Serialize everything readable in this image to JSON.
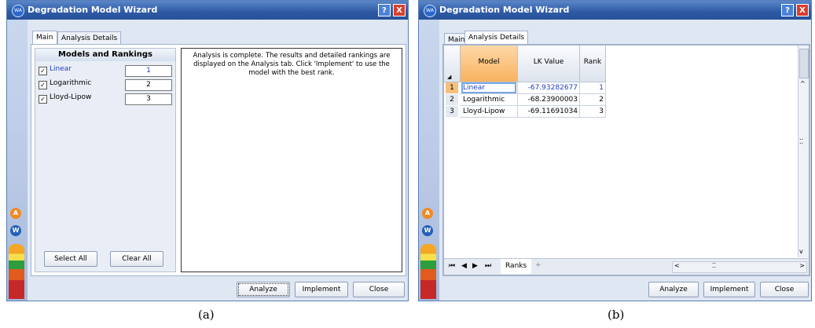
{
  "left": {
    "title": "Degradation Model Wizard",
    "icon": "WA",
    "help_label": "?",
    "close_label": "X",
    "tabs": [
      "Main",
      "Analysis Details"
    ],
    "models_header": "Models and Rankings",
    "models": [
      {
        "name": "Linear",
        "rank": "1"
      },
      {
        "name": "Logarithmic",
        "rank": "2"
      },
      {
        "name": "Lloyd-Lipow",
        "rank": "3"
      }
    ],
    "message": "Analysis is complete. The results and detailed rankings are displayed on the Analysis tab. Click 'Implement' to use the model with the best rank.",
    "select_all": "Select All",
    "clear_all": "Clear All",
    "analyze": "Analyze",
    "implement": "Implement",
    "close": "Close",
    "caption": "(a)"
  },
  "right": {
    "title": "Degradation Model Wizard",
    "icon": "WA",
    "help_label": "?",
    "close_label": "X",
    "tabs": [
      "Main",
      "Analysis Details"
    ],
    "columns": [
      "Model",
      "LK Value",
      "Rank"
    ],
    "rows": [
      {
        "num": "1",
        "model": "Linear",
        "lk": "-67.93282677",
        "rank": "1"
      },
      {
        "num": "2",
        "model": "Logarithmic",
        "lk": "-68.23900003",
        "rank": "2"
      },
      {
        "num": "3",
        "model": "Lloyd-Lipow",
        "lk": "-69.11691034",
        "rank": "3"
      }
    ],
    "sheet_tab": "Ranks",
    "add_sheet": "+",
    "analyze": "Analyze",
    "implement": "Implement",
    "close": "Close",
    "caption": "(b)"
  }
}
